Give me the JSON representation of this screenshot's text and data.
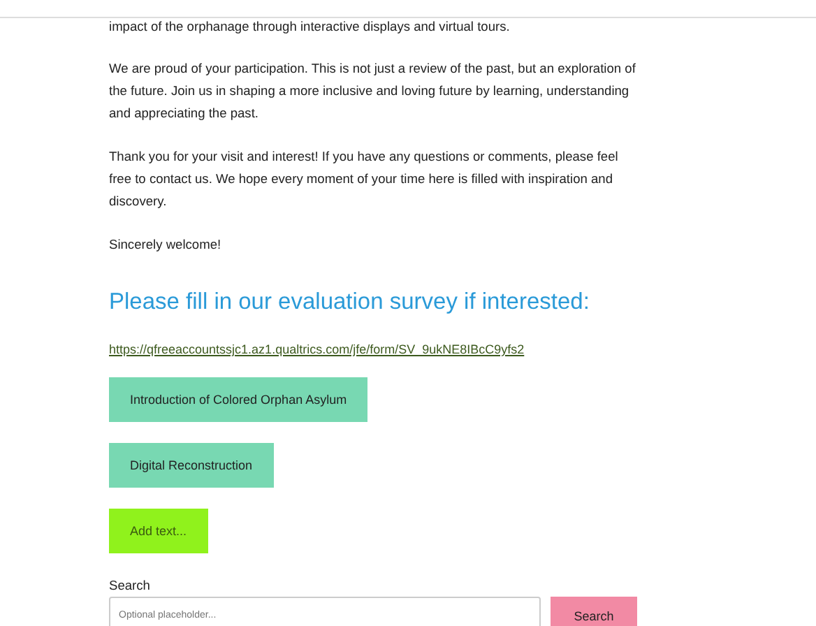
{
  "paragraphs": [
    "impact of the orphanage through interactive displays and virtual tours.",
    "We are proud of your participation. This is not just a review of the past, but an exploration of the future. Join us in shaping a more inclusive and loving future by learning, understanding and appreciating the past.",
    "Thank you for your visit and interest! If you have any questions or comments, please feel free to contact us. We hope every moment of your time here is filled with inspiration and discovery.",
    "Sincerely welcome!"
  ],
  "survey_heading": "Please fill in our evaluation survey if interested:",
  "survey_link": "https://qfreeaccountssjc1.az1.qualtrics.com/jfe/form/SV_9ukNE8IBcC9yfs2",
  "buttons": [
    {
      "label": "Introduction of Colored Orphan Asylum",
      "kind": "teal"
    },
    {
      "label": "Digital Reconstruction",
      "kind": "teal"
    },
    {
      "label": "Add text...",
      "kind": "lime"
    }
  ],
  "search": {
    "label": "Search",
    "placeholder": "Optional placeholder...",
    "button": "Search"
  }
}
